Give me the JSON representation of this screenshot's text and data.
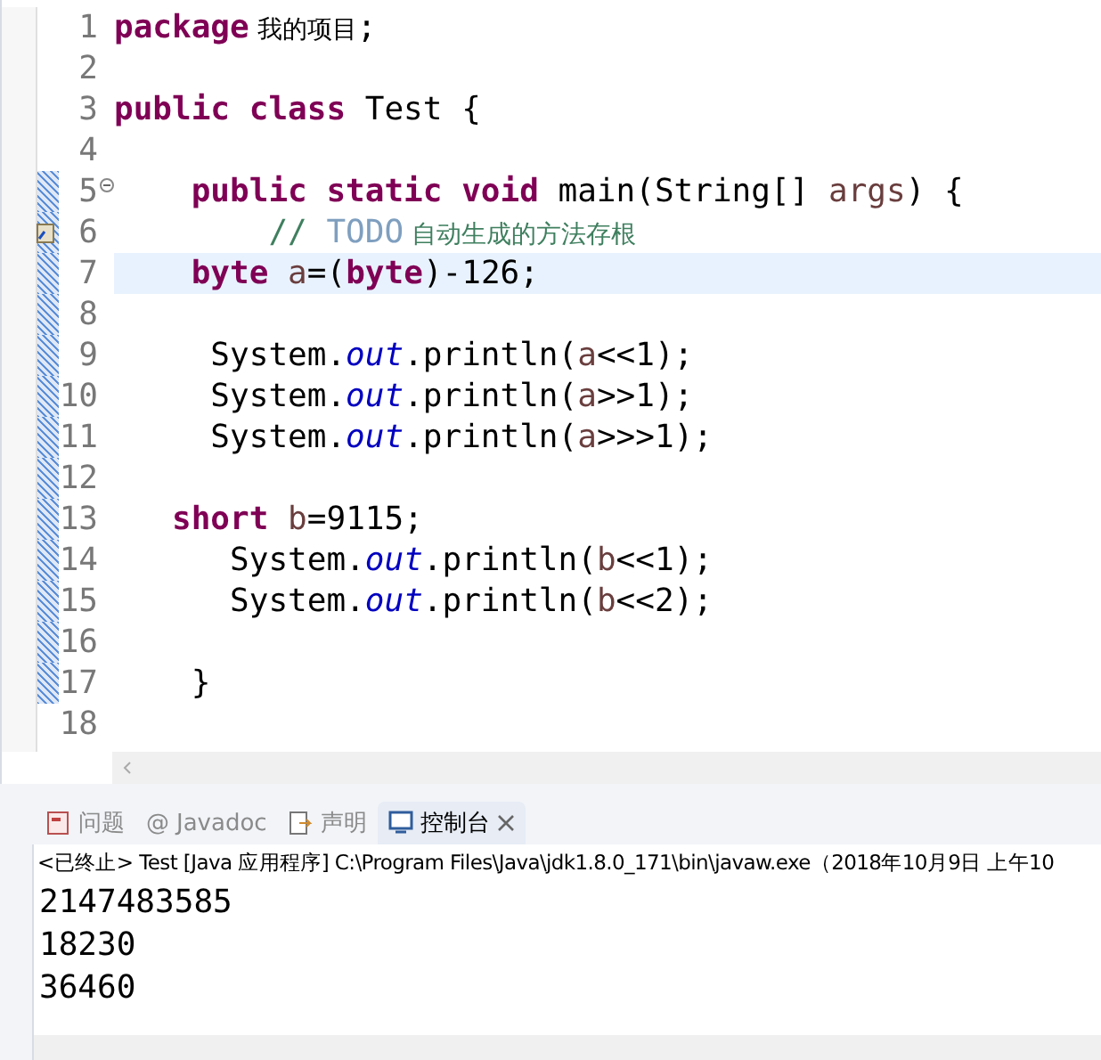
{
  "editor": {
    "lines": [
      {
        "number": "1",
        "highlighted": false,
        "fold": false,
        "task": false,
        "tokens": [
          {
            "kind": "kw",
            "text": "package"
          },
          {
            "kind": "cjk",
            "text": " 我的项目"
          },
          {
            "kind": "plain",
            "text": ";"
          }
        ]
      },
      {
        "number": "2",
        "highlighted": false,
        "fold": false,
        "task": false
      },
      {
        "number": "3",
        "highlighted": false,
        "fold": false,
        "task": false,
        "tokens": [
          {
            "kind": "kw",
            "text": "public class"
          },
          {
            "kind": "plain",
            "text": " Test {"
          }
        ]
      },
      {
        "number": "4",
        "highlighted": false,
        "fold": false,
        "task": false
      },
      {
        "number": "5",
        "highlighted": false,
        "fold": true,
        "task": false,
        "tokens": [
          {
            "kind": "kw",
            "text": "    public static void"
          },
          {
            "kind": "plain",
            "text": " main(String[] "
          },
          {
            "kind": "var",
            "text": "args"
          },
          {
            "kind": "plain",
            "text": ") {"
          }
        ]
      },
      {
        "number": "6",
        "highlighted": false,
        "fold": false,
        "task": true,
        "tokens": [
          {
            "kind": "comment",
            "text": "        //"
          },
          {
            "kind": "todo",
            "text": " TODO"
          },
          {
            "kind": "cjkcomment",
            "text": " 自动生成的方法存根"
          }
        ]
      },
      {
        "number": "7",
        "highlighted": true,
        "fold": false,
        "task": false,
        "tokens": [
          {
            "kind": "kw",
            "text": "    byte"
          },
          {
            "kind": "var",
            "text": " a"
          },
          {
            "kind": "plain",
            "text": "=("
          },
          {
            "kind": "kw",
            "text": "byte"
          },
          {
            "kind": "plain",
            "text": ")-126;"
          }
        ]
      },
      {
        "number": "8",
        "highlighted": false,
        "fold": false,
        "task": false
      },
      {
        "number": "9",
        "highlighted": false,
        "fold": false,
        "task": false,
        "tokens": [
          {
            "kind": "plain",
            "text": "     System."
          },
          {
            "kind": "field",
            "text": "out"
          },
          {
            "kind": "plain",
            "text": ".println("
          },
          {
            "kind": "var",
            "text": "a"
          },
          {
            "kind": "plain",
            "text": "<<1);"
          }
        ]
      },
      {
        "number": "10",
        "highlighted": false,
        "fold": false,
        "task": false,
        "tokens": [
          {
            "kind": "plain",
            "text": "     System."
          },
          {
            "kind": "field",
            "text": "out"
          },
          {
            "kind": "plain",
            "text": ".println("
          },
          {
            "kind": "var",
            "text": "a"
          },
          {
            "kind": "plain",
            "text": ">>1);"
          }
        ]
      },
      {
        "number": "11",
        "highlighted": false,
        "fold": false,
        "task": false,
        "tokens": [
          {
            "kind": "plain",
            "text": "     System."
          },
          {
            "kind": "field",
            "text": "out"
          },
          {
            "kind": "plain",
            "text": ".println("
          },
          {
            "kind": "var",
            "text": "a"
          },
          {
            "kind": "plain",
            "text": ">>>1);"
          }
        ]
      },
      {
        "number": "12",
        "highlighted": false,
        "fold": false,
        "task": false
      },
      {
        "number": "13",
        "highlighted": false,
        "fold": false,
        "task": false,
        "tokens": [
          {
            "kind": "kw",
            "text": "   short"
          },
          {
            "kind": "var",
            "text": " b"
          },
          {
            "kind": "plain",
            "text": "=9115;"
          }
        ]
      },
      {
        "number": "14",
        "highlighted": false,
        "fold": false,
        "task": false,
        "tokens": [
          {
            "kind": "plain",
            "text": "      System."
          },
          {
            "kind": "field",
            "text": "out"
          },
          {
            "kind": "plain",
            "text": ".println("
          },
          {
            "kind": "var",
            "text": "b"
          },
          {
            "kind": "plain",
            "text": "<<1);"
          }
        ]
      },
      {
        "number": "15",
        "highlighted": false,
        "fold": false,
        "task": false,
        "tokens": [
          {
            "kind": "plain",
            "text": "      System."
          },
          {
            "kind": "field",
            "text": "out"
          },
          {
            "kind": "plain",
            "text": ".println("
          },
          {
            "kind": "var",
            "text": "b"
          },
          {
            "kind": "plain",
            "text": "<<2);"
          }
        ]
      },
      {
        "number": "16",
        "highlighted": false,
        "fold": false,
        "task": false
      },
      {
        "number": "17",
        "highlighted": false,
        "fold": false,
        "task": false,
        "tokens": [
          {
            "kind": "plain",
            "text": "    }"
          }
        ]
      },
      {
        "number": "18",
        "highlighted": false,
        "fold": false,
        "task": false
      }
    ]
  },
  "views": {
    "tabs": [
      {
        "kind": "problems",
        "label": "问题",
        "selected": false,
        "closable": false
      },
      {
        "kind": "javadoc",
        "glyph": "@",
        "label": "Javadoc",
        "selected": false,
        "closable": false
      },
      {
        "kind": "declaration",
        "label": "声明",
        "selected": false,
        "closable": false
      },
      {
        "kind": "console",
        "label": "控制台",
        "selected": true,
        "closable": true
      }
    ]
  },
  "console": {
    "header": "<已终止> Test [Java 应用程序] C:\\Program Files\\Java\\jdk1.8.0_171\\bin\\javaw.exe（2018年10月9日 上午10",
    "output": [
      "2147483585",
      "18230",
      "36460"
    ]
  }
}
